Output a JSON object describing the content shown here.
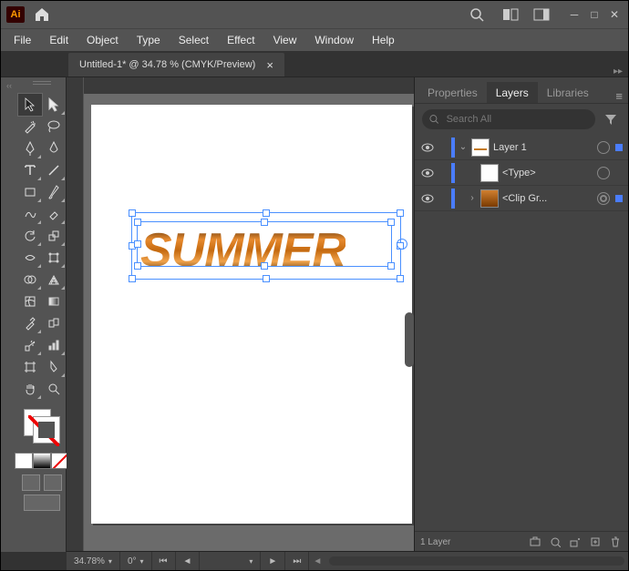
{
  "app_badge": "Ai",
  "menus": [
    "File",
    "Edit",
    "Object",
    "Type",
    "Select",
    "Effect",
    "View",
    "Window",
    "Help"
  ],
  "tab": {
    "title": "Untitled-1* @ 34.78 % (CMYK/Preview)"
  },
  "canvas_text": "SUMMER",
  "panels": {
    "tabs": [
      "Properties",
      "Layers",
      "Libraries"
    ],
    "active": 1,
    "search_placeholder": "Search All",
    "layers": [
      {
        "name": "Layer 1",
        "expanded": true,
        "has_children": true,
        "thumb": "doc",
        "targeted": false,
        "selected": true,
        "level": 0
      },
      {
        "name": "<Type>",
        "expanded": false,
        "has_children": false,
        "thumb": "blank",
        "targeted": false,
        "selected": false,
        "level": 1
      },
      {
        "name": "<Clip Gr...",
        "expanded": false,
        "has_children": true,
        "thumb": "img",
        "targeted": true,
        "selected": true,
        "level": 1
      }
    ],
    "footer_label": "1 Layer"
  },
  "status": {
    "zoom": "34.78%",
    "rotate": "0°"
  },
  "tooltips": {
    "selection": "Selection Tool",
    "direct": "Direct Selection Tool"
  }
}
